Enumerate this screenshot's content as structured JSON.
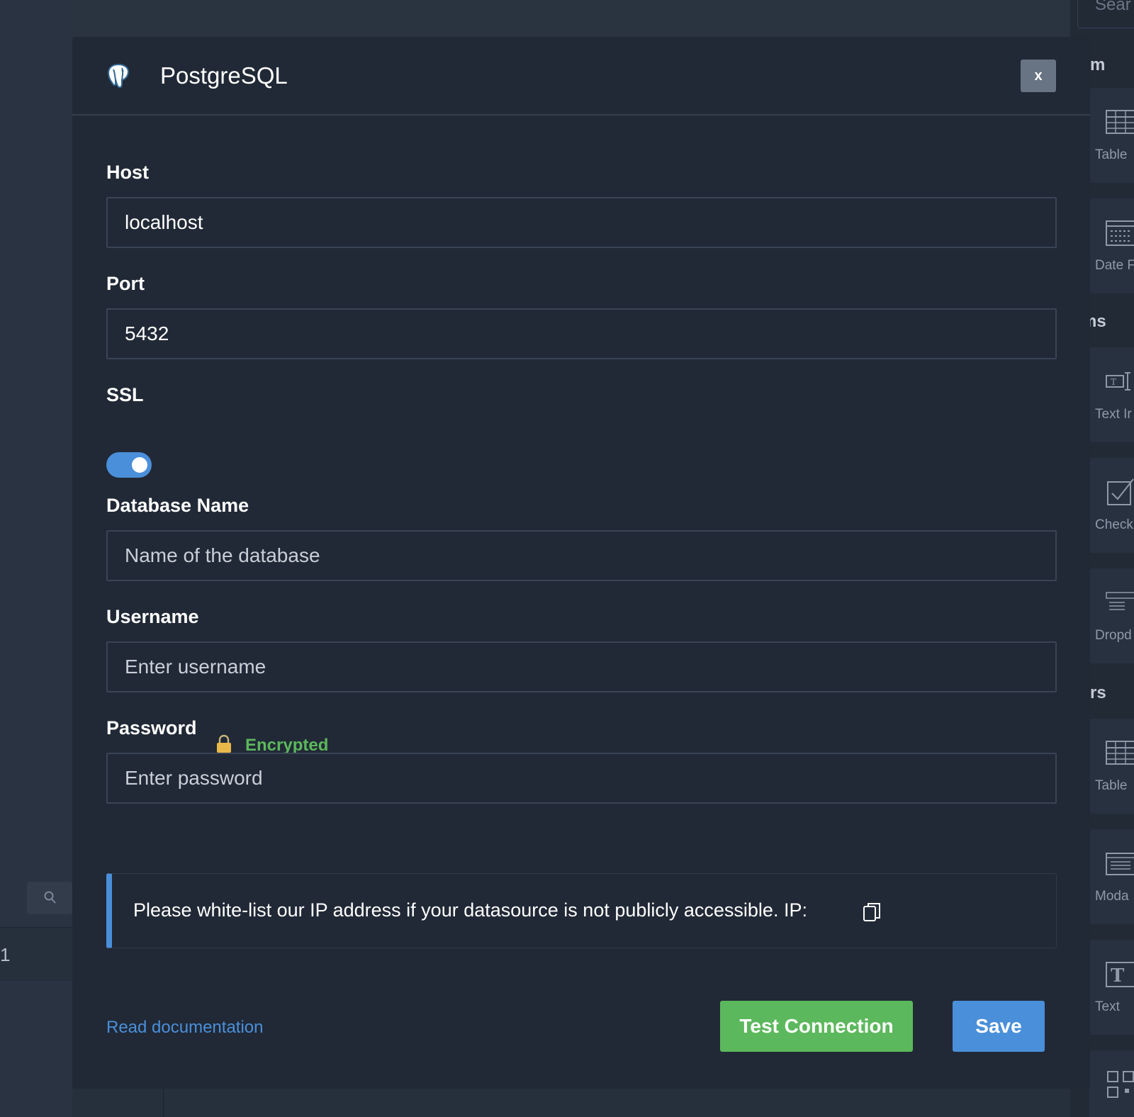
{
  "modal": {
    "title": "PostgreSQL",
    "close_label": "x",
    "fields": {
      "host": {
        "label": "Host",
        "value": "localhost"
      },
      "port": {
        "label": "Port",
        "value": "5432"
      },
      "ssl": {
        "label": "SSL",
        "enabled": true
      },
      "database": {
        "label": "Database Name",
        "value": "",
        "placeholder": "Name of the database"
      },
      "username": {
        "label": "Username",
        "value": "",
        "placeholder": "Enter username"
      },
      "password": {
        "label": "Password",
        "value": "",
        "placeholder": "Enter password",
        "badge": "Encrypted"
      }
    },
    "info": {
      "text": "Please white-list our IP address if your datasource is not publicly accessible. IP:"
    },
    "footer": {
      "doc_link": "Read documentation",
      "test_label": "Test Connection",
      "save_label": "Save"
    }
  },
  "background": {
    "left_row_number": "1",
    "right_panel": {
      "search_placeholder": "Sear",
      "sections": [
        "omm",
        "orms",
        "thers"
      ],
      "components": [
        "Table",
        "Date F",
        "Text Ir",
        "Check",
        "Dropd",
        "Table",
        "Moda",
        "Text"
      ]
    }
  },
  "colors": {
    "primary": "#4a8fd9",
    "success": "#5cb85c",
    "modal_bg": "#212936",
    "border": "#394456"
  }
}
